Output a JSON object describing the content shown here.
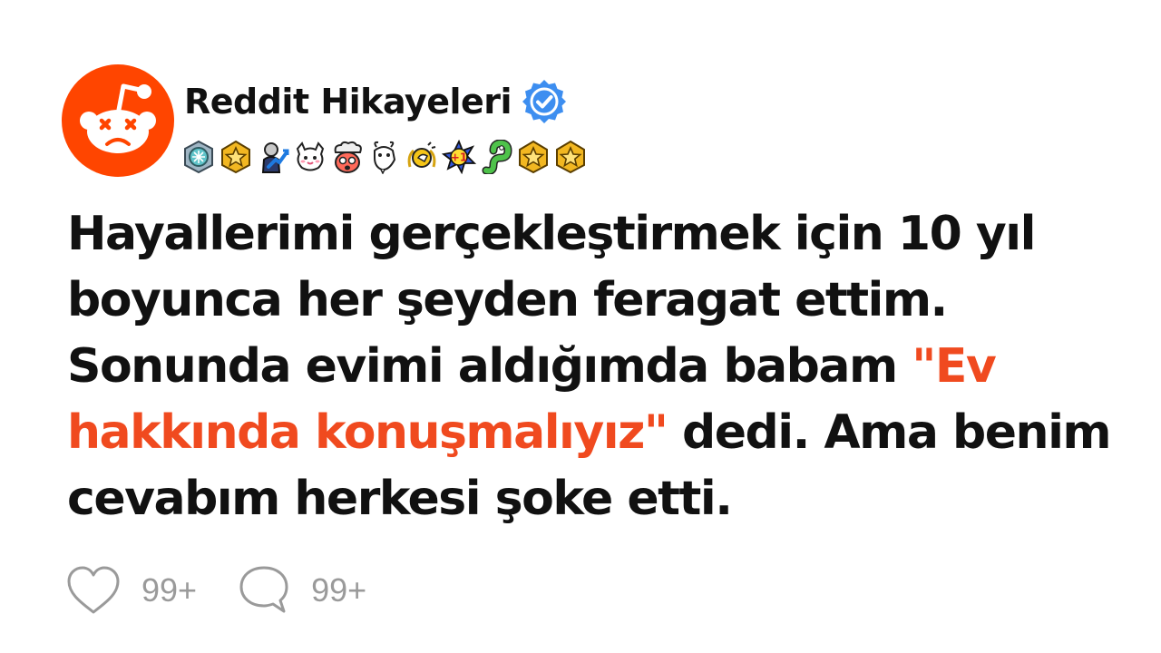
{
  "channel": {
    "name": "Reddit Hikayeleri",
    "verified": true,
    "avatar_icon": "reddit-alien-icon",
    "brand_color": "#ff4500",
    "verified_color": "#3d8ef0"
  },
  "awards": [
    {
      "name": "platinum-award-icon"
    },
    {
      "name": "star-award-icon"
    },
    {
      "name": "stonks-award-icon"
    },
    {
      "name": "wholesome-award-icon"
    },
    {
      "name": "mind-blown-award-icon"
    },
    {
      "name": "goat-award-icon"
    },
    {
      "name": "helpful-award-icon"
    },
    {
      "name": "plus-one-award-icon"
    },
    {
      "name": "snek-award-icon"
    },
    {
      "name": "star-award-icon"
    },
    {
      "name": "star-award-icon"
    }
  ],
  "post": {
    "title_before": "Hayallerimi gerçekleştirmek için 10 yıl boyunca her şeyden feragat ettim. Sonunda evimi aldığımda babam ",
    "title_highlight": "\"Ev hakkında konuşmalıyız\"",
    "title_after": " dedi. Ama benim cevabım herkesi şoke etti.",
    "highlight_color": "#f04a1f"
  },
  "actions": {
    "like_count": "99+",
    "comment_count": "99+",
    "like_icon": "heart-icon",
    "comment_icon": "comment-bubble-icon"
  }
}
